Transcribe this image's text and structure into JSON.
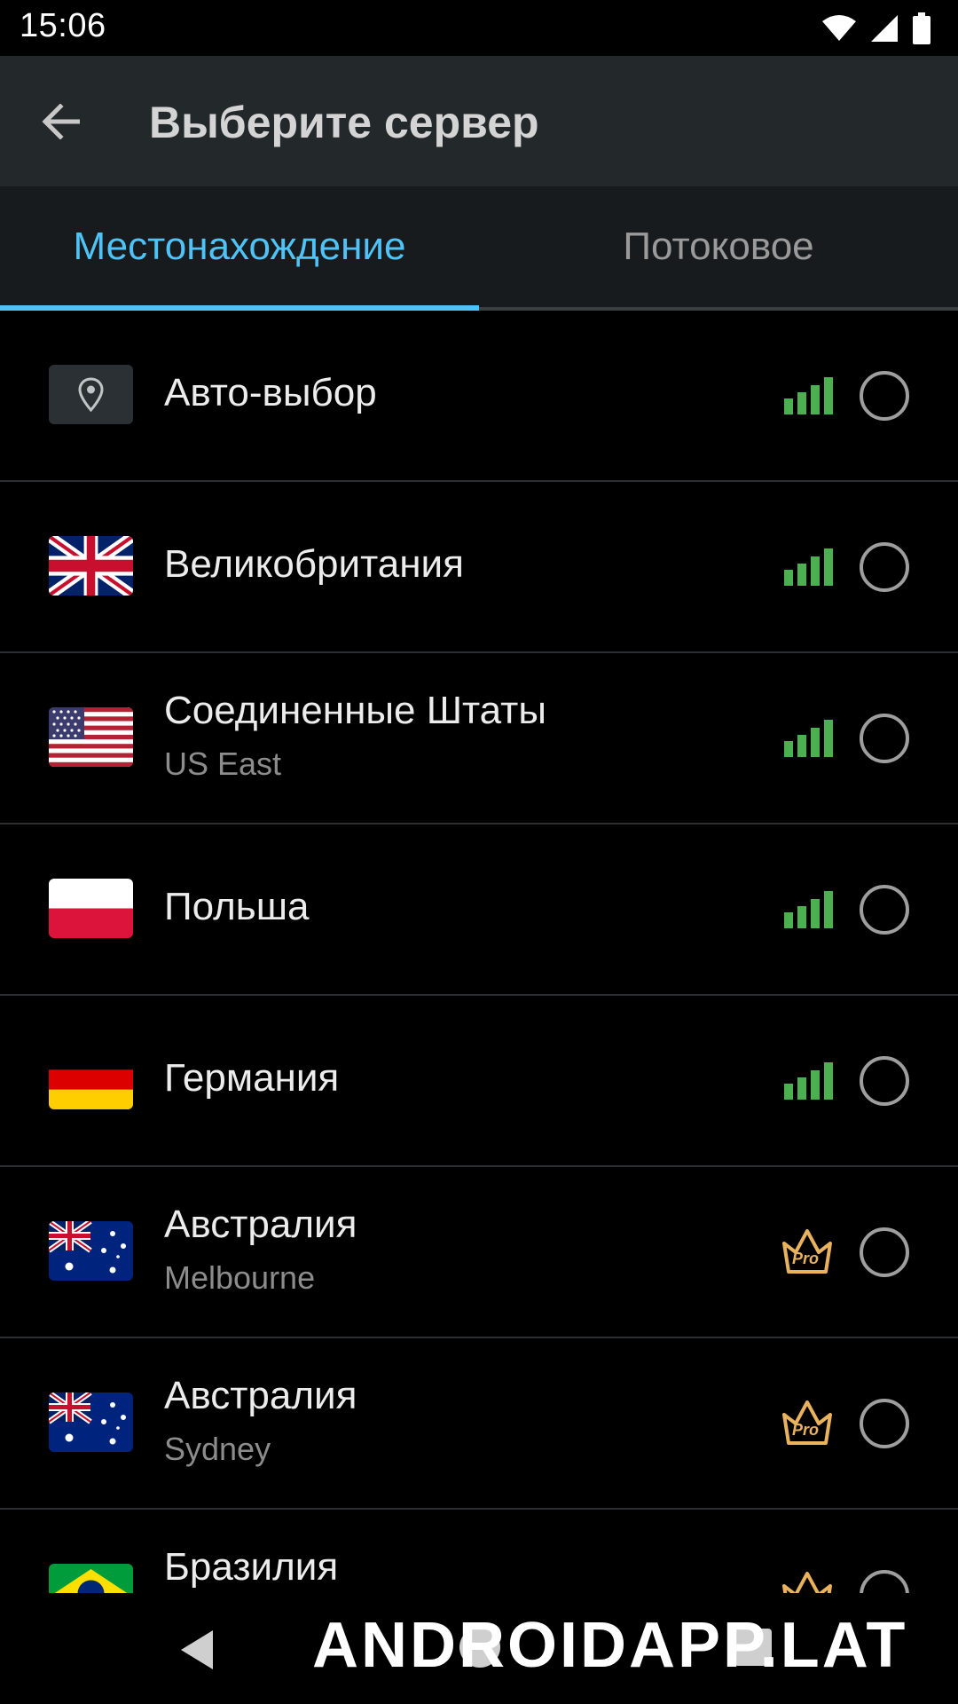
{
  "status_bar": {
    "time": "15:06"
  },
  "app_bar": {
    "title": "Выберите сервер"
  },
  "tabs": [
    {
      "label": "Местонахождение",
      "active": true
    },
    {
      "label": "Потоковое",
      "active": false
    }
  ],
  "servers": [
    {
      "name": "Авто-выбор",
      "subtitle": "",
      "flag": "location-pin-icon",
      "status": "signal",
      "selected": false
    },
    {
      "name": "Великобритания",
      "subtitle": "",
      "flag": "uk-flag",
      "status": "signal",
      "selected": false
    },
    {
      "name": "Соединенные Штаты",
      "subtitle": "US East",
      "flag": "us-flag",
      "status": "signal",
      "selected": false
    },
    {
      "name": "Польша",
      "subtitle": "",
      "flag": "poland-flag",
      "status": "signal",
      "selected": false
    },
    {
      "name": "Германия",
      "subtitle": "",
      "flag": "germany-flag",
      "status": "signal",
      "selected": false
    },
    {
      "name": "Австралия",
      "subtitle": "Melbourne",
      "flag": "australia-flag",
      "status": "pro",
      "selected": false
    },
    {
      "name": "Австралия",
      "subtitle": "Sydney",
      "flag": "australia-flag",
      "status": "pro",
      "selected": false
    },
    {
      "name": "Бразилия",
      "subtitle": "",
      "flag": "brazil-flag",
      "status": "pro",
      "selected": false
    }
  ],
  "pro_badge": {
    "label": "Pro"
  },
  "watermark": "ANDROIDAPP.LAT",
  "colors": {
    "accent": "#4fc3f7",
    "signal": "#4caf50",
    "pro": "#e9b25c",
    "app_bar": "#23282b"
  }
}
